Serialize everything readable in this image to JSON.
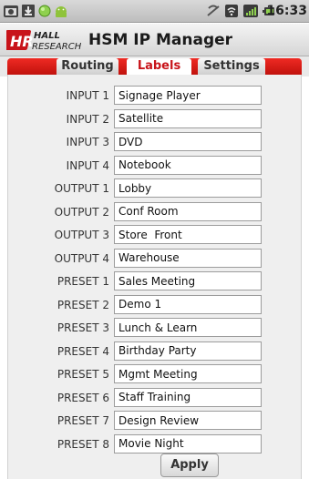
{
  "status_bar": {
    "time": "16:33",
    "icons": [
      "screenshot-icon",
      "download-icon",
      "green-status-icon",
      "android-icon",
      "no-signal-icon",
      "wifi-icon",
      "signal-bars-icon",
      "battery-icon"
    ]
  },
  "header": {
    "logo_text_hr": "HR",
    "logo_text_hall": "HALL",
    "logo_text_research": "RESEARCH",
    "title": "HSM IP Manager"
  },
  "tabs": [
    {
      "label": "Routing",
      "active": false
    },
    {
      "label": "Labels",
      "active": true
    },
    {
      "label": "Settings",
      "active": false
    }
  ],
  "labels": {
    "rows": [
      {
        "label": "INPUT 1",
        "value": "Signage Player"
      },
      {
        "label": "INPUT 2",
        "value": "Satellite"
      },
      {
        "label": "INPUT 3",
        "value": "DVD"
      },
      {
        "label": "INPUT 4",
        "value": "Notebook"
      },
      {
        "label": "OUTPUT 1",
        "value": "Lobby"
      },
      {
        "label": "OUTPUT 2",
        "value": "Conf Room"
      },
      {
        "label": "OUTPUT 3",
        "value": "Store  Front"
      },
      {
        "label": "OUTPUT 4",
        "value": "Warehouse"
      },
      {
        "label": "PRESET 1",
        "value": "Sales Meeting"
      },
      {
        "label": "PRESET 2",
        "value": "Demo 1"
      },
      {
        "label": "PRESET 3",
        "value": "Lunch & Learn"
      },
      {
        "label": "PRESET 4",
        "value": "Birthday Party"
      },
      {
        "label": "PRESET 5",
        "value": "Mgmt Meeting"
      },
      {
        "label": "PRESET 6",
        "value": "Staff Training"
      },
      {
        "label": "PRESET 7",
        "value": "Design Review"
      },
      {
        "label": "PRESET 8",
        "value": "Movie Night"
      }
    ],
    "apply_label": "Apply"
  },
  "colors": {
    "accent_red": "#d7191f",
    "active_tab_text": "#c8141a",
    "panel_bg": "#efefef"
  }
}
